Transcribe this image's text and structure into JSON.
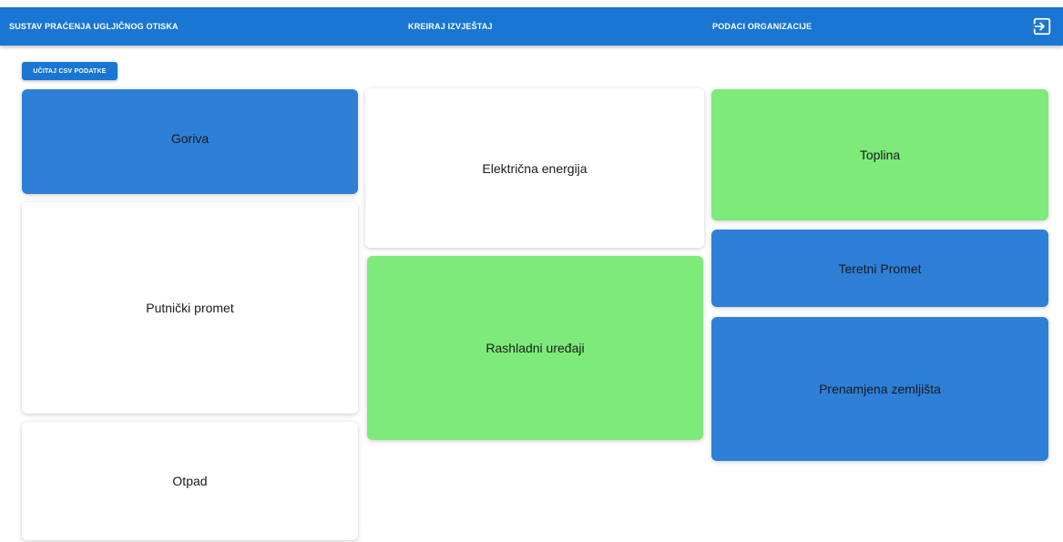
{
  "colors": {
    "appbar": "#1976d2",
    "blue_card": "#2e7fd8",
    "green_card": "#7dea7a",
    "white_card": "#ffffff"
  },
  "nav": {
    "brand": "SUSTAV PRAĆENJA UGLJIČNOG OTISKA",
    "report": "KREIRAJ IZVJEŠTAJ",
    "organization": "PODACI ORGANIZACIJE",
    "logout_icon": "logout-icon"
  },
  "actions": {
    "load_csv": "UČITAJ CSV PODATKE"
  },
  "cards": {
    "goriva": "Goriva",
    "putnicki": "Putnički promet",
    "otpad": "Otpad",
    "elektricna": "Električna energija",
    "rashladni": "Rashladni uređaji",
    "toplina": "Toplina",
    "teretni": "Teretni Promet",
    "prenamjena": "Prenamjena zemljišta"
  }
}
